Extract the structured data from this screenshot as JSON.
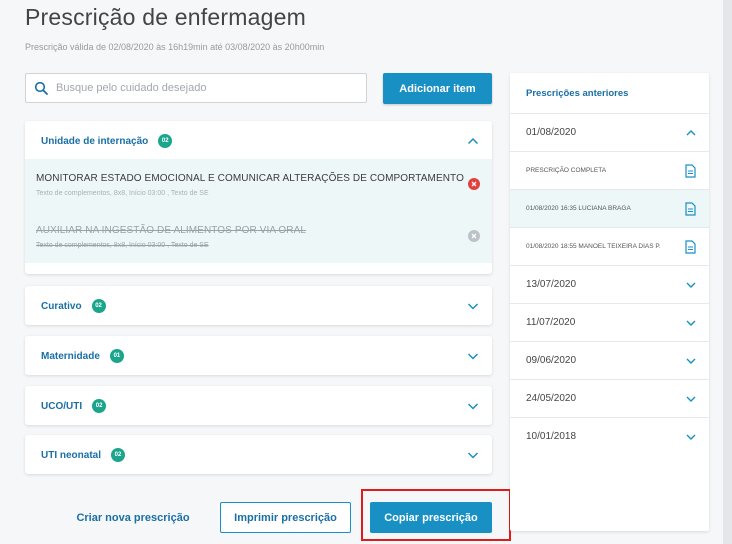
{
  "header": {
    "title": "Prescrição de enfermagem",
    "validity": "Prescrição válida de 02/08/2020 às 16h19min até 03/08/2020 às 20h00min"
  },
  "search": {
    "placeholder": "Busque pelo cuidado desejado",
    "value": ""
  },
  "toolbar": {
    "add_label": "Adicionar item"
  },
  "sections": [
    {
      "title": "Unidade de internação",
      "count": "02",
      "expanded": true,
      "items": [
        {
          "name": "MONITORAR ESTADO EMOCIONAL E COMUNICAR ALTERAÇÕES DE COMPORTAMENTO",
          "complement": "Texto de complementos, 8x8, Início 03:00 , Texto de SE",
          "struck": false
        },
        {
          "name": "AUXILIAR NA INGESTÃO DE ALIMENTOS POR VIA ORAL",
          "complement": "Texto de complementos, 8x8, Início 03:00 , Texto de SE",
          "struck": true
        }
      ]
    },
    {
      "title": "Curativo",
      "count": "02",
      "expanded": false
    },
    {
      "title": "Maternidade",
      "count": "01",
      "expanded": false
    },
    {
      "title": "UCO/UTI",
      "count": "02",
      "expanded": false
    },
    {
      "title": "UTI neonatal",
      "count": "02",
      "expanded": false
    }
  ],
  "actions": {
    "new_label": "Criar nova prescrição",
    "print_label": "Imprimir prescrição",
    "copy_label": "Copiar prescrição"
  },
  "previous": {
    "title": "Prescrições anteriores",
    "groups": [
      {
        "date": "01/08/2020",
        "expanded": true,
        "entries": [
          {
            "label": "PRESCRIÇÃO COMPLETA",
            "selected": false
          },
          {
            "label": "01/08/2020 16:35 LUCIANA BRAGA",
            "selected": true
          },
          {
            "label": "01/08/2020 18:55 MANOEL TEIXEIRA DIAS P.",
            "selected": false
          }
        ]
      },
      {
        "date": "13/07/2020",
        "expanded": false
      },
      {
        "date": "11/07/2020",
        "expanded": false
      },
      {
        "date": "09/06/2020",
        "expanded": false
      },
      {
        "date": "24/05/2020",
        "expanded": false
      },
      {
        "date": "10/01/2018",
        "expanded": false
      }
    ]
  },
  "colors": {
    "primary": "#1890c4",
    "badge": "#1ba68c",
    "danger": "#e0413e",
    "highlight": "#e11b1b",
    "item_bg": "#eef7f8"
  },
  "icons": {
    "search": "search-icon",
    "chevron_up": "chevron-up-icon",
    "chevron_down": "chevron-down-icon",
    "remove": "remove-icon",
    "remove_disabled": "remove-disabled-icon",
    "document": "document-icon"
  }
}
